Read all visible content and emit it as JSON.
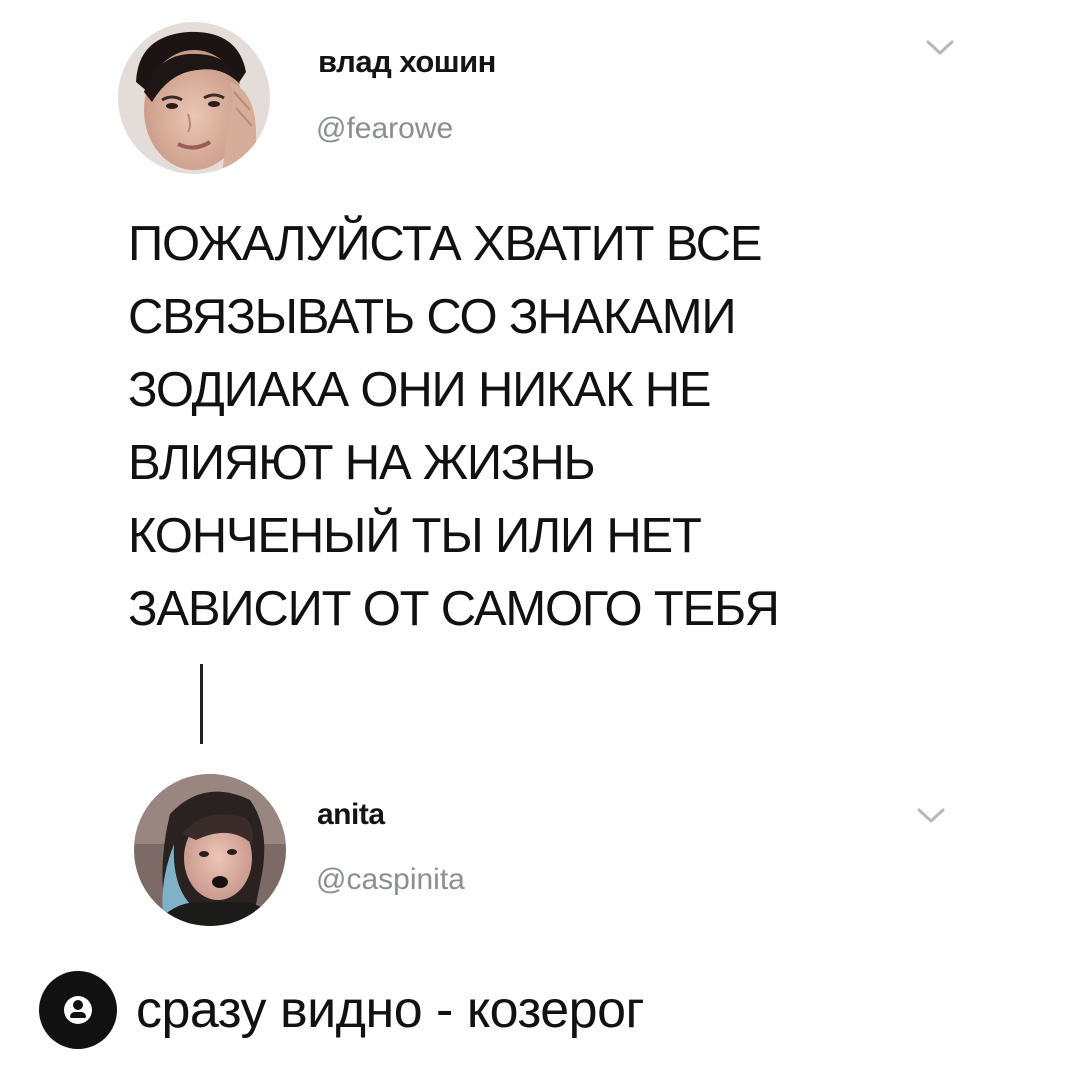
{
  "tweet": {
    "author": {
      "display_name": "влад хошин",
      "handle": "@fearowe",
      "avatar_icon": "user-avatar-photo"
    },
    "menu_icon": "chevron-down-icon",
    "text": "ПОЖАЛУЙСТА ХВАТИТ ВСЕ\nСВЯЗЫВАТЬ СО ЗНАКАМИ\nЗОДИАКА ОНИ НИКАК НЕ\nВЛИЯЮТ НА ЖИЗНЬ\nКОНЧЕНЫЙ ТЫ ИЛИ НЕТ\nЗАВИСИТ ОТ САМОГО ТЕБЯ"
  },
  "reply": {
    "author": {
      "display_name": "anita",
      "handle": "@caspinita",
      "avatar_icon": "user-avatar-photo"
    },
    "menu_icon": "chevron-down-icon",
    "text": "сразу видно - козерог"
  },
  "badge_icon": "instagram-user-badge-icon",
  "colors": {
    "text": "#111111",
    "handle": "#8a8f94",
    "chevron": "#b5b9bd",
    "background": "#ffffff"
  }
}
